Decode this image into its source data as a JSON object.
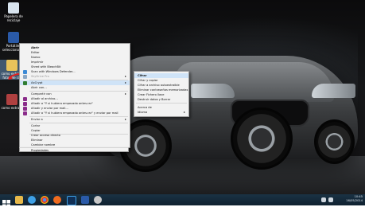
{
  "desktop": {
    "icons": [
      {
        "label_line1": "Papelera de",
        "label_line2": "reciclaje",
        "icon": "recycle-bin-icon"
      },
      {
        "label_line1": "Portátiles",
        "label_line2": "seleccionados",
        "icon": "word-document-icon"
      },
      {
        "label_line1": "como extraer",
        "label_line2": "fotos de rar",
        "icon": "folder-icon"
      },
      {
        "label_line1": "como extraer",
        "label_line2": "",
        "icon": "shortcut-icon"
      }
    ]
  },
  "context_menu": {
    "items": [
      {
        "label": "Abrir",
        "bold": true
      },
      {
        "label": "Editar"
      },
      {
        "label": "Nuevo"
      },
      {
        "label": "Imprimir"
      },
      {
        "label": "Shred with BleachBit"
      },
      {
        "label": "Scan with Windows Defender..."
      },
      {
        "label": "SkyDrive Pro",
        "disabled": true,
        "submenu": true
      },
      {
        "label": "AxCrypt",
        "submenu": true,
        "highlight": true
      },
      {
        "label": "Abrir con..."
      },
      {
        "label": "Compartir con",
        "submenu": true
      },
      {
        "label": "Añadir al archivo..."
      },
      {
        "label": "Añadir a \"Y si hubiera empezado antes.rar\""
      },
      {
        "label": "Añadir y enviar por mail..."
      },
      {
        "label": "Añadir a \"Y si hubiera empezado antes.rar\" y enviar por mail"
      },
      {
        "label": "Enviar a",
        "submenu": true
      },
      {
        "label": "Cortar"
      },
      {
        "label": "Copiar"
      },
      {
        "label": "Crear acceso directo"
      },
      {
        "label": "Eliminar"
      },
      {
        "label": "Cambiar nombre"
      },
      {
        "label": "Propiedades"
      }
    ]
  },
  "submenu": {
    "items": [
      {
        "label": "Cifrar",
        "highlight": true
      },
      {
        "label": "Cifrar y copiar"
      },
      {
        "label": "Cifrar a archivo autoextraíble"
      },
      {
        "label": "Eliminar contraseñas memorizadas"
      },
      {
        "label": "Crear Fichero llave"
      },
      {
        "label": "Destruir datos y Borrar"
      },
      {
        "label": "Acerca de"
      },
      {
        "label": "Idioma",
        "submenu": true
      }
    ]
  },
  "taskbar": {
    "time": "10:45",
    "date": "16/05/2014",
    "buttons": [
      "start-icon",
      "file-explorer-icon",
      "ie-icon",
      "chrome-icon",
      "photoshop-icon",
      "word-icon",
      "app-icon"
    ]
  },
  "colors": {
    "menu_bg": "#f2f2f2",
    "menu_highlight": "#cfe3f7",
    "taskbar": "#1a3244",
    "annotation_red": "#e02020"
  }
}
